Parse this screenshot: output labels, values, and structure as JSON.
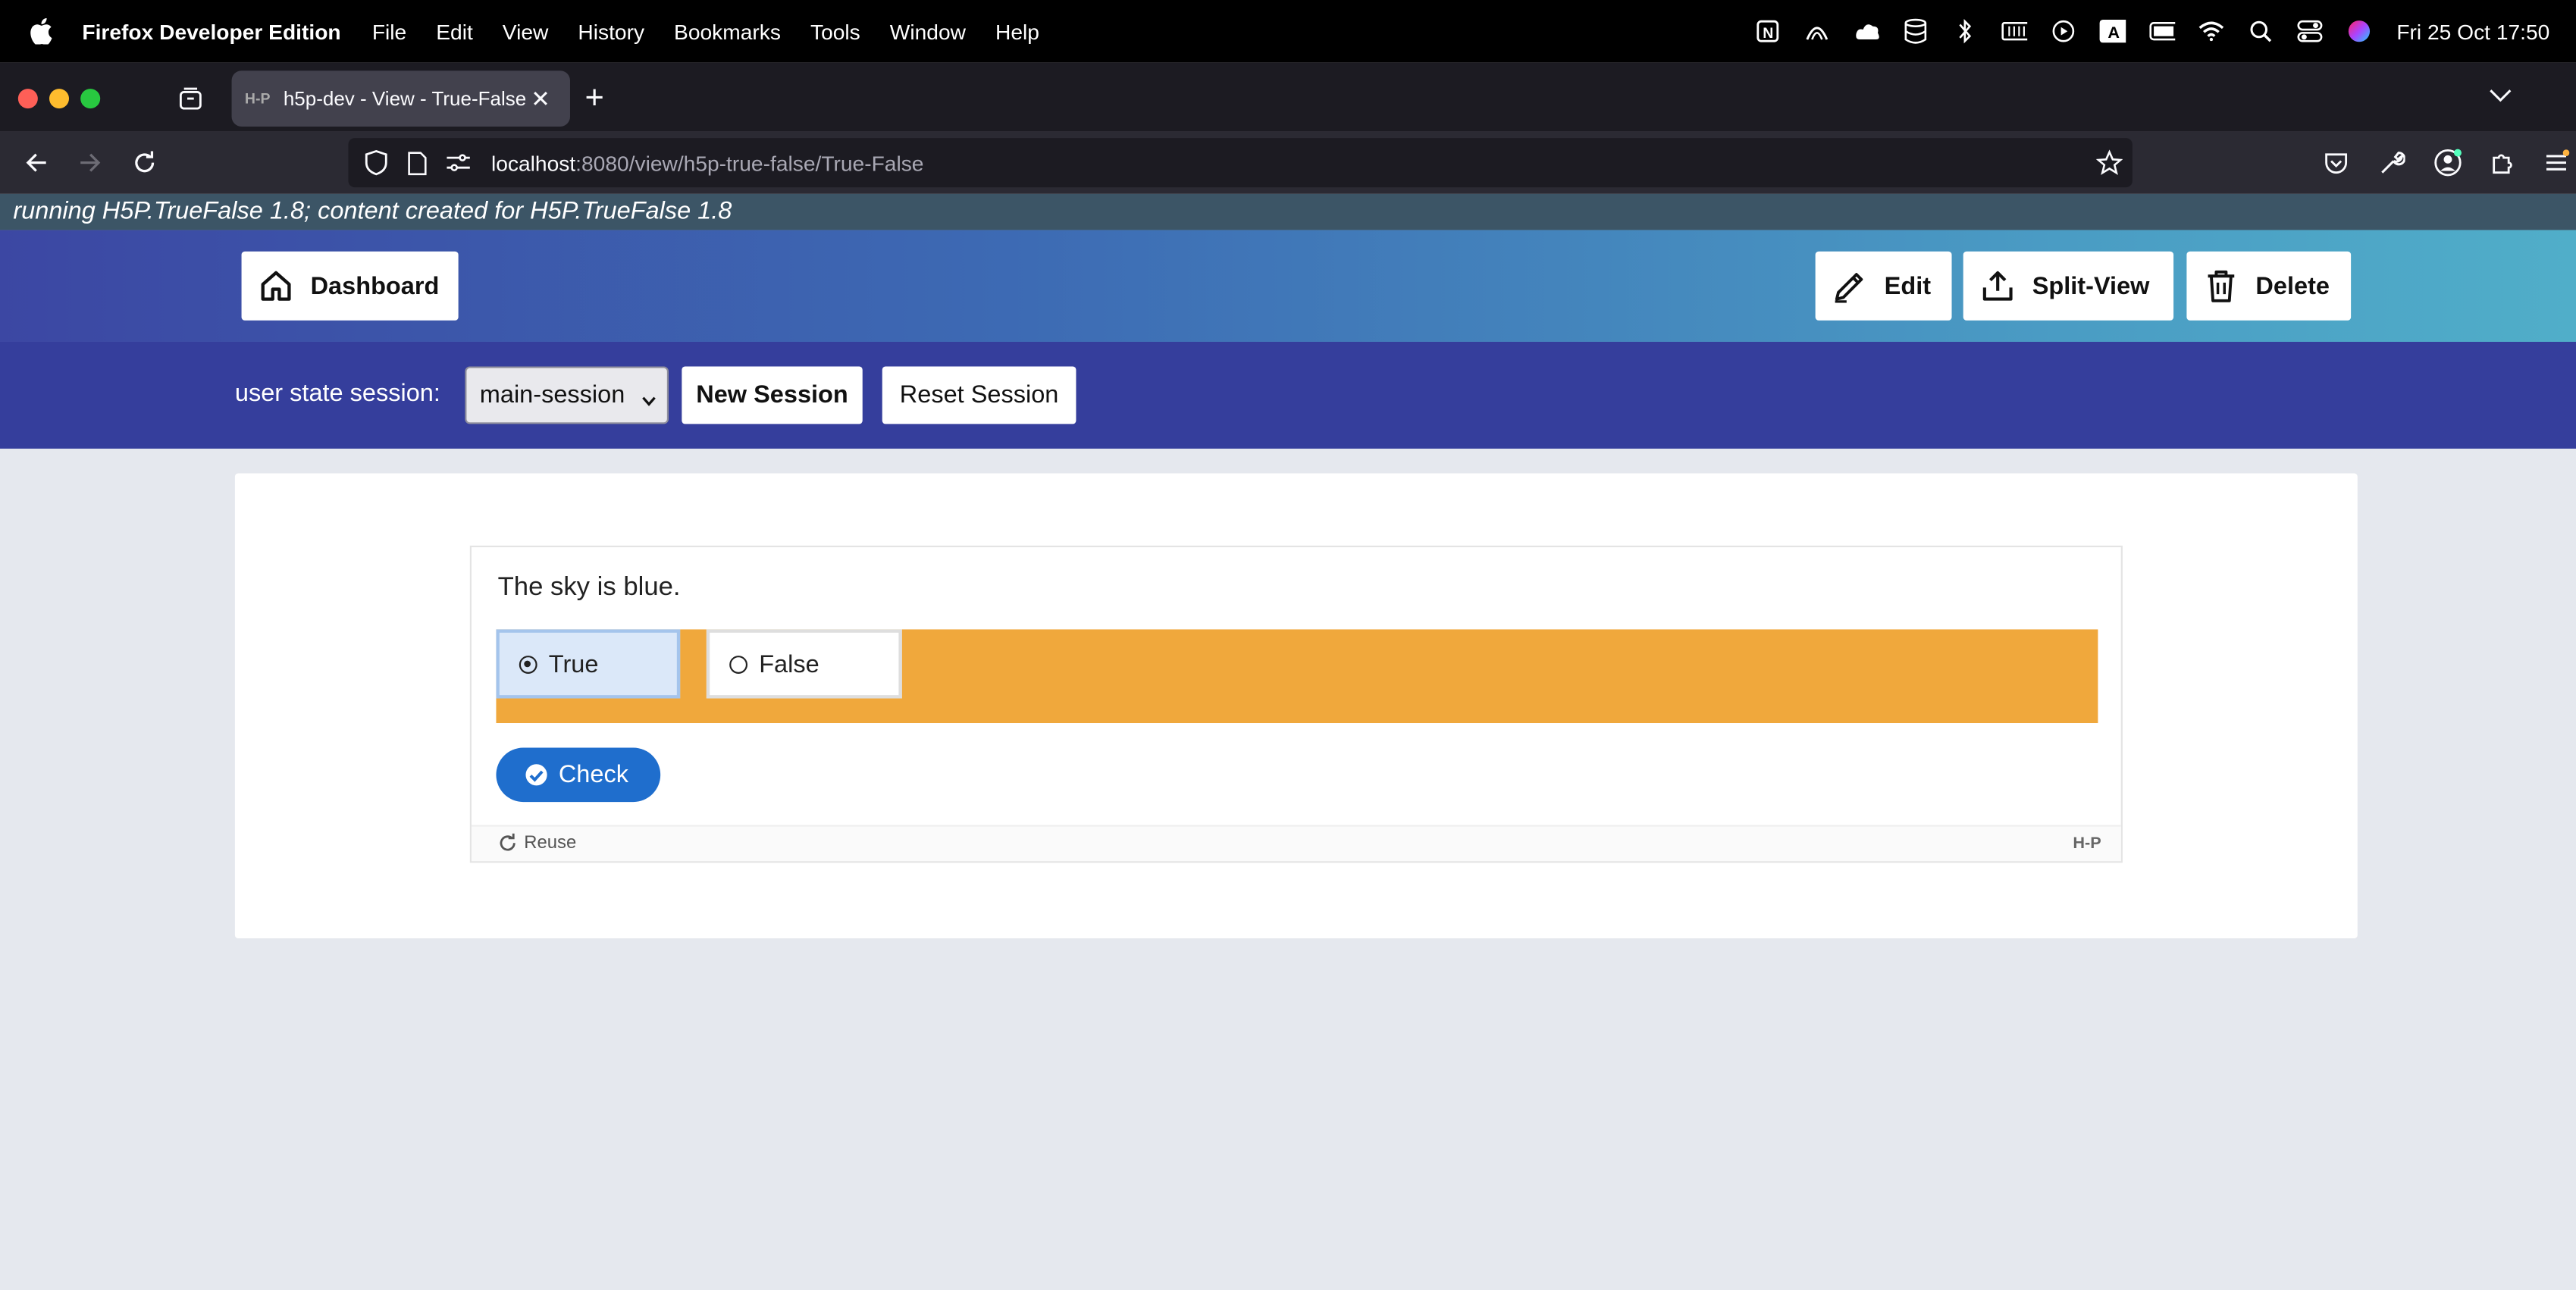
{
  "menubar": {
    "app_name": "Firefox Developer Edition",
    "items": [
      "File",
      "Edit",
      "View",
      "History",
      "Bookmarks",
      "Tools",
      "Window",
      "Help"
    ],
    "clock": "Fri 25 Oct  17:50"
  },
  "browser": {
    "tab_favicon": "H-P",
    "tab_title": "h5p-dev - View - True-False",
    "url_host": "localhost",
    "url_path": ":8080/view/h5p-true-false/True-False"
  },
  "page": {
    "run_info": "running H5P.TrueFalse 1.8; content created for H5P.TrueFalse 1.8",
    "header": {
      "dashboard_label": "Dashboard",
      "edit_label": "Edit",
      "split_view_label": "Split-View",
      "delete_label": "Delete"
    },
    "session": {
      "label": "user state session:",
      "selected": "main-session",
      "new_session_label": "New Session",
      "reset_session_label": "Reset Session"
    },
    "h5p": {
      "question": "The sky is blue.",
      "answers": [
        {
          "label": "True",
          "selected": true
        },
        {
          "label": "False",
          "selected": false
        }
      ],
      "check_label": "Check",
      "reuse_label": "Reuse",
      "logo_text": "H-P"
    }
  },
  "colors": {
    "answer_bar": "#f0a83c",
    "check_button": "#1f6ecd",
    "session_bar": "#353e9c"
  }
}
